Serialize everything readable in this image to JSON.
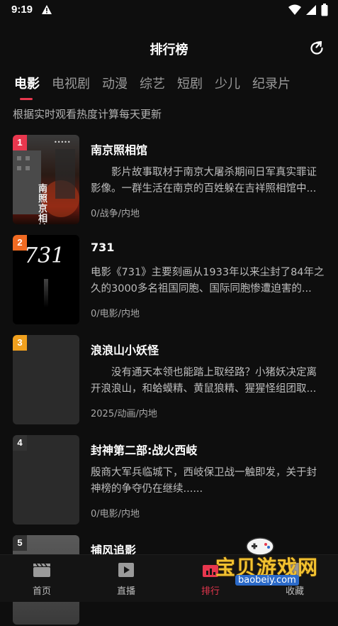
{
  "status_bar": {
    "time": "9:19"
  },
  "header": {
    "title": "排行榜"
  },
  "tabs": [
    {
      "label": "电影",
      "active": true
    },
    {
      "label": "电视剧"
    },
    {
      "label": "动漫"
    },
    {
      "label": "综艺"
    },
    {
      "label": "短剧"
    },
    {
      "label": "少儿"
    },
    {
      "label": "纪录片"
    }
  ],
  "subtitle": "根据实时观看热度计算每天更新",
  "items": [
    {
      "rank": "1",
      "rank_color": "#e8374e",
      "title": "南京照相馆",
      "desc": "　　影片故事取材于南京大屠杀期间日军真实罪证影像。一群生活在南京的百姓躲在吉祥照相馆中...",
      "meta": "0/战争/内地",
      "poster_label": "南京照相馆"
    },
    {
      "rank": "2",
      "rank_color": "#f06a22",
      "title": "731",
      "desc": "电影《731》主要刻画从1933年以来尘封了84年之久的3000多名祖国同胞、国际同胞惨遭迫害的...",
      "meta": "0/电影/内地",
      "poster_label": "731"
    },
    {
      "rank": "3",
      "rank_color": "#f0a01e",
      "title": "浪浪山小妖怪",
      "desc": "　　没有通天本领也能踏上取经路？小猪妖决定离开浪浪山，和蛤蟆精、黄鼠狼精、猩猩怪组团取...",
      "meta": "2025/动画/内地"
    },
    {
      "rank": "4",
      "rank_color": "#2e2e2e",
      "title": "封神第二部:战火西岐",
      "desc": "殷商大军兵临城下，西岐保卫战一触即发，关于封神榜的争夺仍在继续......",
      "meta": "0/电影/内地"
    },
    {
      "rank": "5",
      "rank_color": "#2e2e2e",
      "title": "捕风追影",
      "desc": "",
      "meta": ""
    }
  ],
  "bottom_nav": [
    {
      "label": "首页",
      "icon": "clapperboard-icon"
    },
    {
      "label": "直播",
      "icon": "play-icon"
    },
    {
      "label": "排行",
      "icon": "ranking-icon",
      "active": true
    },
    {
      "label": "收藏",
      "icon": "bookmark-icon"
    }
  ],
  "watermark": {
    "text": "宝贝游戏网",
    "url": "baobeiy.com"
  },
  "colors": {
    "accent": "#e8374e",
    "background": "#0e0e0e"
  }
}
